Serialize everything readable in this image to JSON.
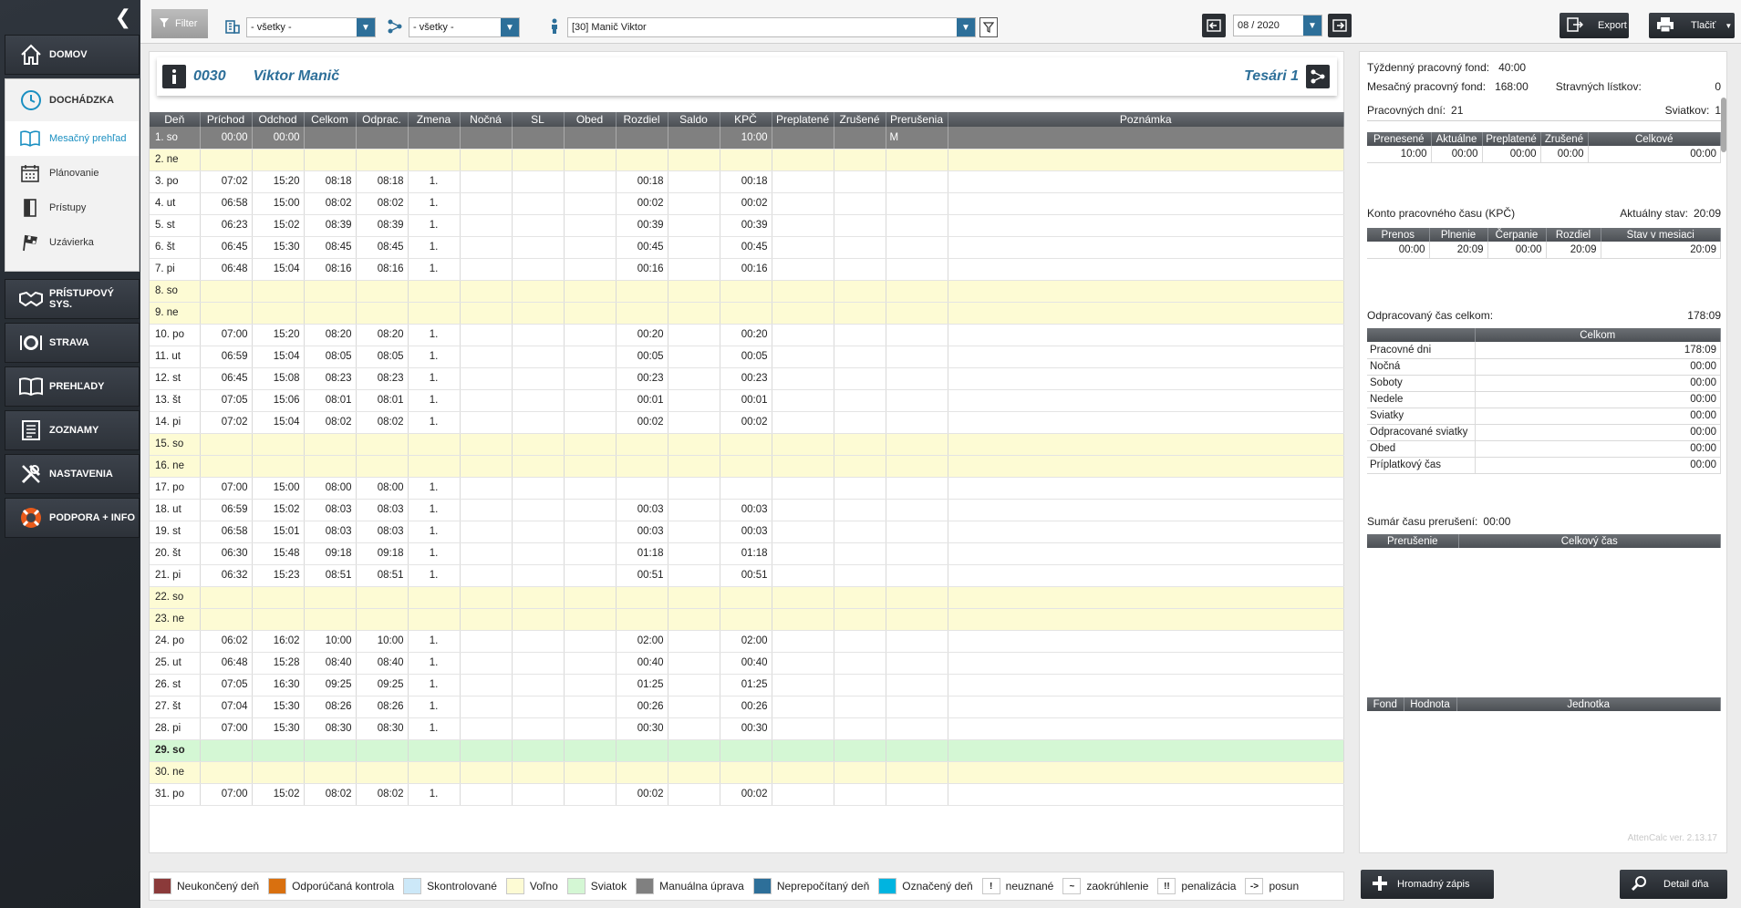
{
  "sidebar": {
    "collapse_label": "❮",
    "home_label": "DOMOV",
    "attendance": {
      "label": "DOCHÁDZKA",
      "items": [
        {
          "label": "Mesačný prehľad",
          "active": true,
          "icon": "book-open-icon"
        },
        {
          "label": "Plánovanie",
          "active": false,
          "icon": "calendar-icon"
        },
        {
          "label": "Prístupy",
          "active": false,
          "icon": "door-icon"
        },
        {
          "label": "Uzávierka",
          "active": false,
          "icon": "flag-icon"
        }
      ]
    },
    "main_items": [
      {
        "label": "PRÍSTUPOVÝ SYS.",
        "icon": "handshake-icon"
      },
      {
        "label": "STRAVA",
        "icon": "plate-icon"
      },
      {
        "label": "PREHĽADY",
        "icon": "open-book-icon"
      },
      {
        "label": "ZOZNAMY",
        "icon": "list-icon"
      },
      {
        "label": "NASTAVENIA",
        "icon": "tools-icon"
      },
      {
        "label": "PODPORA + INFO",
        "icon": "lifebuoy-icon"
      }
    ]
  },
  "toolbar": {
    "filter_label": "Filter",
    "building_select": "- všetky -",
    "structure_select": "- všetky -",
    "employee_select": "[30] Manič Viktor",
    "month_value": "08 / 2020",
    "export_label": "Export",
    "print_label": "Tlačiť"
  },
  "employee": {
    "id": "0030",
    "name": "Viktor Manič",
    "group": "Tesári 1"
  },
  "table": {
    "headers": [
      "Deň",
      "Príchod",
      "Odchod",
      "Celkom",
      "Odprac.",
      "Zmena",
      "Nočná",
      "SL",
      "Obed",
      "Rozdiel",
      "Saldo",
      "KPČ",
      "Preplatené",
      "Zrušené",
      "Prerušenia",
      "Poznámka"
    ],
    "rows": [
      {
        "type": "selected",
        "cells": [
          "1. so",
          "00:00",
          "00:00",
          "",
          "",
          "",
          "",
          "",
          "",
          "",
          "",
          "10:00",
          "",
          "",
          "M",
          ""
        ]
      },
      {
        "type": "weekend",
        "cells": [
          "2. ne",
          "",
          "",
          "",
          "",
          "",
          "",
          "",
          "",
          "",
          "",
          "",
          "",
          "",
          "",
          ""
        ]
      },
      {
        "type": "normal",
        "cells": [
          "3. po",
          "07:02",
          "15:20",
          "08:18",
          "08:18",
          "1.",
          "",
          "",
          "",
          "00:18",
          "",
          "00:18",
          "",
          "",
          "",
          ""
        ]
      },
      {
        "type": "normal",
        "cells": [
          "4. ut",
          "06:58",
          "15:00",
          "08:02",
          "08:02",
          "1.",
          "",
          "",
          "",
          "00:02",
          "",
          "00:02",
          "",
          "",
          "",
          ""
        ]
      },
      {
        "type": "normal",
        "cells": [
          "5. st",
          "06:23",
          "15:02",
          "08:39",
          "08:39",
          "1.",
          "",
          "",
          "",
          "00:39",
          "",
          "00:39",
          "",
          "",
          "",
          ""
        ]
      },
      {
        "type": "normal",
        "cells": [
          "6. št",
          "06:45",
          "15:30",
          "08:45",
          "08:45",
          "1.",
          "",
          "",
          "",
          "00:45",
          "",
          "00:45",
          "",
          "",
          "",
          ""
        ]
      },
      {
        "type": "normal",
        "cells": [
          "7. pi",
          "06:48",
          "15:04",
          "08:16",
          "08:16",
          "1.",
          "",
          "",
          "",
          "00:16",
          "",
          "00:16",
          "",
          "",
          "",
          ""
        ]
      },
      {
        "type": "weekend",
        "cells": [
          "8. so",
          "",
          "",
          "",
          "",
          "",
          "",
          "",
          "",
          "",
          "",
          "",
          "",
          "",
          "",
          ""
        ]
      },
      {
        "type": "weekend",
        "cells": [
          "9. ne",
          "",
          "",
          "",
          "",
          "",
          "",
          "",
          "",
          "",
          "",
          "",
          "",
          "",
          "",
          ""
        ]
      },
      {
        "type": "normal",
        "cells": [
          "10. po",
          "07:00",
          "15:20",
          "08:20",
          "08:20",
          "1.",
          "",
          "",
          "",
          "00:20",
          "",
          "00:20",
          "",
          "",
          "",
          ""
        ]
      },
      {
        "type": "normal",
        "cells": [
          "11. ut",
          "06:59",
          "15:04",
          "08:05",
          "08:05",
          "1.",
          "",
          "",
          "",
          "00:05",
          "",
          "00:05",
          "",
          "",
          "",
          ""
        ]
      },
      {
        "type": "normal",
        "cells": [
          "12. st",
          "06:45",
          "15:08",
          "08:23",
          "08:23",
          "1.",
          "",
          "",
          "",
          "00:23",
          "",
          "00:23",
          "",
          "",
          "",
          ""
        ]
      },
      {
        "type": "normal",
        "cells": [
          "13. št",
          "07:05",
          "15:06",
          "08:01",
          "08:01",
          "1.",
          "",
          "",
          "",
          "00:01",
          "",
          "00:01",
          "",
          "",
          "",
          ""
        ]
      },
      {
        "type": "normal",
        "cells": [
          "14. pi",
          "07:02",
          "15:04",
          "08:02",
          "08:02",
          "1.",
          "",
          "",
          "",
          "00:02",
          "",
          "00:02",
          "",
          "",
          "",
          ""
        ]
      },
      {
        "type": "weekend",
        "cells": [
          "15. so",
          "",
          "",
          "",
          "",
          "",
          "",
          "",
          "",
          "",
          "",
          "",
          "",
          "",
          "",
          ""
        ]
      },
      {
        "type": "weekend",
        "cells": [
          "16. ne",
          "",
          "",
          "",
          "",
          "",
          "",
          "",
          "",
          "",
          "",
          "",
          "",
          "",
          "",
          ""
        ]
      },
      {
        "type": "normal",
        "cells": [
          "17. po",
          "07:00",
          "15:00",
          "08:00",
          "08:00",
          "1.",
          "",
          "",
          "",
          "",
          "",
          "",
          "",
          "",
          "",
          ""
        ]
      },
      {
        "type": "normal",
        "cells": [
          "18. ut",
          "06:59",
          "15:02",
          "08:03",
          "08:03",
          "1.",
          "",
          "",
          "",
          "00:03",
          "",
          "00:03",
          "",
          "",
          "",
          ""
        ]
      },
      {
        "type": "normal",
        "cells": [
          "19. st",
          "06:58",
          "15:01",
          "08:03",
          "08:03",
          "1.",
          "",
          "",
          "",
          "00:03",
          "",
          "00:03",
          "",
          "",
          "",
          ""
        ]
      },
      {
        "type": "normal",
        "cells": [
          "20. št",
          "06:30",
          "15:48",
          "09:18",
          "09:18",
          "1.",
          "",
          "",
          "",
          "01:18",
          "",
          "01:18",
          "",
          "",
          "",
          ""
        ]
      },
      {
        "type": "normal",
        "cells": [
          "21. pi",
          "06:32",
          "15:23",
          "08:51",
          "08:51",
          "1.",
          "",
          "",
          "",
          "00:51",
          "",
          "00:51",
          "",
          "",
          "",
          ""
        ]
      },
      {
        "type": "weekend",
        "cells": [
          "22. so",
          "",
          "",
          "",
          "",
          "",
          "",
          "",
          "",
          "",
          "",
          "",
          "",
          "",
          "",
          ""
        ]
      },
      {
        "type": "weekend",
        "cells": [
          "23. ne",
          "",
          "",
          "",
          "",
          "",
          "",
          "",
          "",
          "",
          "",
          "",
          "",
          "",
          "",
          ""
        ]
      },
      {
        "type": "normal",
        "cells": [
          "24. po",
          "06:02",
          "16:02",
          "10:00",
          "10:00",
          "1.",
          "",
          "",
          "",
          "02:00",
          "",
          "02:00",
          "",
          "",
          "",
          ""
        ]
      },
      {
        "type": "normal",
        "cells": [
          "25. ut",
          "06:48",
          "15:28",
          "08:40",
          "08:40",
          "1.",
          "",
          "",
          "",
          "00:40",
          "",
          "00:40",
          "",
          "",
          "",
          ""
        ]
      },
      {
        "type": "normal",
        "cells": [
          "26. st",
          "07:05",
          "16:30",
          "09:25",
          "09:25",
          "1.",
          "",
          "",
          "",
          "01:25",
          "",
          "01:25",
          "",
          "",
          "",
          ""
        ]
      },
      {
        "type": "normal",
        "cells": [
          "27. št",
          "07:04",
          "15:30",
          "08:26",
          "08:26",
          "1.",
          "",
          "",
          "",
          "00:26",
          "",
          "00:26",
          "",
          "",
          "",
          ""
        ]
      },
      {
        "type": "normal",
        "cells": [
          "28. pi",
          "07:00",
          "15:30",
          "08:30",
          "08:30",
          "1.",
          "",
          "",
          "",
          "00:30",
          "",
          "00:30",
          "",
          "",
          "",
          ""
        ]
      },
      {
        "type": "holiday",
        "cells": [
          "29. so",
          "",
          "",
          "",
          "",
          "",
          "",
          "",
          "",
          "",
          "",
          "",
          "",
          "",
          "",
          ""
        ]
      },
      {
        "type": "weekend",
        "cells": [
          "30. ne",
          "",
          "",
          "",
          "",
          "",
          "",
          "",
          "",
          "",
          "",
          "",
          "",
          "",
          "",
          ""
        ]
      },
      {
        "type": "normal",
        "cells": [
          "31. po",
          "07:00",
          "15:02",
          "08:02",
          "08:02",
          "1.",
          "",
          "",
          "",
          "00:02",
          "",
          "00:02",
          "",
          "",
          "",
          ""
        ]
      }
    ]
  },
  "legend": [
    {
      "kind": "swatch",
      "color": "#8b3a3a",
      "label": "Neukončený deň"
    },
    {
      "kind": "swatch",
      "color": "#d9700f",
      "label": "Odporúčaná kontrola"
    },
    {
      "kind": "swatch",
      "color": "#cce8f8",
      "label": "Skontrolované"
    },
    {
      "kind": "swatch",
      "color": "#fdfbd4",
      "label": "Voľno"
    },
    {
      "kind": "swatch",
      "color": "#d4f7d4",
      "label": "Sviatok"
    },
    {
      "kind": "swatch",
      "color": "#808080",
      "label": "Manuálna úprava"
    },
    {
      "kind": "swatch",
      "color": "#2d6f99",
      "label": "Neprepočítaný deň"
    },
    {
      "kind": "swatch",
      "color": "#00b4e0",
      "label": "Označený deň"
    },
    {
      "kind": "symbol",
      "symbol": "!",
      "label": "neuznané"
    },
    {
      "kind": "symbol",
      "symbol": "~",
      "label": "zaokrúhlenie"
    },
    {
      "kind": "symbol",
      "symbol": "!!",
      "label": "penalizácia"
    },
    {
      "kind": "symbol",
      "symbol": "->",
      "label": "posun"
    }
  ],
  "summary": {
    "weekly_fund_label": "Týždenný pracovný fond:",
    "weekly_fund_value": "40:00",
    "monthly_fund_label": "Mesačný pracovný fond:",
    "monthly_fund_value": "168:00",
    "meal_tickets_label": "Stravných lístkov:",
    "meal_tickets_value": "0",
    "work_days_label": "Pracovných dní:",
    "work_days_value": "21",
    "holidays_label": "Sviatkov:",
    "holidays_value": "1",
    "overtime_table": {
      "headers": [
        "Prenesené",
        "Aktuálne",
        "Preplatené",
        "Zrušené",
        "Celkové"
      ],
      "values": [
        "10:00",
        "00:00",
        "00:00",
        "00:00",
        "00:00"
      ]
    },
    "kpc_label": "Konto pracovného času (KPČ)",
    "kpc_state_label": "Aktuálny stav:",
    "kpc_state_value": "20:09",
    "kpc_table": {
      "headers": [
        "Prenos",
        "Plnenie",
        "Čerpanie",
        "Rozdiel",
        "Stav v mesiaci"
      ],
      "values": [
        "00:00",
        "20:09",
        "00:00",
        "20:09",
        "20:09"
      ]
    },
    "worked_total_label": "Odpracovaný čas celkom:",
    "worked_total_value": "178:09",
    "worked_table": {
      "header": "Celkom",
      "rows": [
        {
          "label": "Pracovné dni",
          "value": "178:09"
        },
        {
          "label": "Nočná",
          "value": "00:00"
        },
        {
          "label": "Soboty",
          "value": "00:00"
        },
        {
          "label": "Nedele",
          "value": "00:00"
        },
        {
          "label": "Sviatky",
          "value": "00:00"
        },
        {
          "label": "Odpracované sviatky",
          "value": "00:00"
        },
        {
          "label": "Obed",
          "value": "00:00"
        },
        {
          "label": "Príplatkový čas",
          "value": "00:00"
        }
      ]
    },
    "interrupt_label": "Sumár času prerušení:",
    "interrupt_value": "00:00",
    "interrupt_headers": [
      "Prerušenie",
      "Celkový čas"
    ],
    "fund_headers": [
      "Fond",
      "Hodnota",
      "Jednotka"
    ],
    "version": "AttenCalc ver. 2.13.17"
  },
  "bottom": {
    "bulk_label": "Hromadný zápis",
    "detail_label": "Detail dňa"
  }
}
